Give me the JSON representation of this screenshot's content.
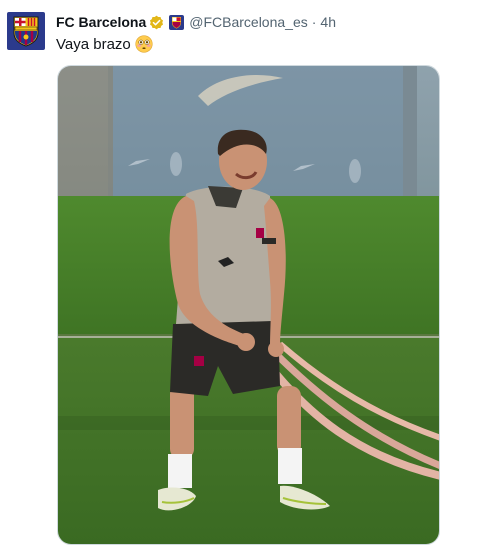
{
  "tweet": {
    "display_name": "FC Barcelona",
    "handle": "@FCBarcelona_es",
    "separator": "·",
    "time": "4h",
    "text": "Vaya brazo",
    "emoji": "flushed-face-emoji",
    "verified_color": "#e2b719",
    "avatar_icon": "fc-barcelona-crest-icon",
    "media_description_icon": "photo"
  }
}
